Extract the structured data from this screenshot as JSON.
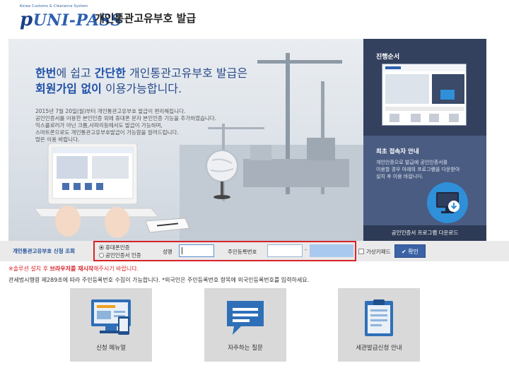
{
  "header": {
    "logo_small": "Korea Customs & Clearance System",
    "logo_text": "UNI-PASS",
    "logo_p": "p",
    "title": "개인통관고유부호 발급"
  },
  "hero": {
    "headline_1_hl1": "한번",
    "headline_1_mid": "에 쉽고 ",
    "headline_1_hl2": "간단한",
    "headline_1_end": " 개인통관고유부호 발급은",
    "headline_2_hl": "회원가입 없이",
    "headline_2_end": " 이용가능합니다.",
    "body_lines": [
      "2015년 7월 20일(월)부터 개인통관고유부호 발급이 편리해집니다.",
      "공인인증서를 이용한 본인인증 외에 휴대폰 문자 본인인증 기능을 추가하였습니다.",
      "익스플로러가 아닌 크롬,사파리등에서도 발급이 가능하며,",
      "스마트폰으로도 개인통관고유부호발급이 가능함을 알려드립니다.",
      "많은 이용 바랍니다."
    ]
  },
  "side": {
    "process_title": "진행순서",
    "first_user_title": "최초 접속자 안내",
    "first_user_lines": [
      "개인인증으로 발급에 공인인증서를",
      "이용할 경우 아래의 프로그램을 다운받아",
      "설치 후 이용 바랍니다."
    ],
    "download_label": "공인인증서 프로그램 다운로드"
  },
  "search": {
    "label": "개인통관고유부호 신청 조회",
    "radio_phone": "휴대폰인증",
    "radio_cert": "공인인증서 인증",
    "name_label": "성명",
    "rrn_label": "주민등록번호",
    "dash": "-",
    "virtual_keypad": "가상키패드",
    "confirm": "확인"
  },
  "notice": {
    "lead": "※솔루션 설치 후 ",
    "emph": "브라우저를 재시작",
    "tail": "해주시기 바랍니다."
  },
  "law_text": "관세법시행령 제289조에 따라 주민등록번호 수집이 가능합니다.  *외국인은 주민등록번호 항목에 외국인등록번호를 입력하세요.",
  "cards": [
    {
      "label": "신청 메뉴얼",
      "icon": "manual-monitor-icon"
    },
    {
      "label": "자주하는 질문",
      "icon": "faq-speech-bubble-icon"
    },
    {
      "label": "세관발급신청 안내",
      "icon": "clipboard-icon"
    }
  ],
  "colors": {
    "brand_blue": "#2c5fb0",
    "side_dark": "#33415f",
    "alert_red": "#d8232a",
    "confirm_btn": "#3b62a6"
  }
}
